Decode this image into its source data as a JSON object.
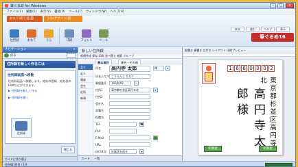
{
  "window": {
    "title": "筆ぐるめ for Windows"
  },
  "menu": [
    "ファイル(F)",
    "編集(E)",
    "表示(V)",
    "書式(O)",
    "ツール(T)",
    "ウィンドウ(W)",
    "ヘルプ(H)"
  ],
  "ribbon": {
    "tab_omote": "おもて(宛て名)面",
    "tab_ura": "うら(デザイン)面",
    "buttons": [
      "住所録",
      "おもて",
      "うら",
      "印刷",
      "フォント",
      "ツール"
    ],
    "mini_tabs": [
      "戻る",
      "進む",
      "ヘルプ",
      "表示"
    ],
    "brand": "筆ぐるめ16",
    "brand_color": "#c62d2d"
  },
  "left_panel": {
    "header": "ナビゲーション",
    "strip_label": "戻る",
    "section_title": "住所録を新しく作るには",
    "box_heading": "住所録画面へ移動",
    "para": "住所録画面へ移動します。宛先の登録、宛名面の印刷などができます。",
    "link1": "▶ 住所録を新しく作る",
    "link2": "▶ 住所録を開く",
    "pic_label": "住所録",
    "tail_button": "閉じる",
    "status": "ガイドに切り替え"
  },
  "address_book": {
    "title": "新しい住所録",
    "toolbar": "新規作成  保存  印刷  並べ替え  検索  グループ",
    "tabs": [
      "基本項目",
      "連名・その他"
    ],
    "groups": [
      "全て",
      "友人",
      "親戚",
      "会社",
      "近所",
      "新規"
    ],
    "fields": {
      "name_label": "氏名",
      "name_value": "高円寺 太郎",
      "honorific": "様",
      "furigana_label": "氏名ふりがな",
      "furigana_value": "こうえんじ たろう",
      "zip_label": "郵便番号",
      "zip_value": "1660002",
      "address_label": "住所1",
      "address_value": "東京都杉並区高円寺北",
      "address2_label": "住所2",
      "company_label": "会社名",
      "dept_label": "部署名",
      "title_label": "役職名",
      "tel_label": "TEL",
      "fax_label": "FAX",
      "email_label": "E-Mail",
      "url_label": "URL",
      "memo_label": "メモ",
      "mark_label": "マーク",
      "send_label": "送付状況",
      "send_value": "年賀状を送る"
    },
    "footer": [
      "カード",
      "一覧"
    ]
  },
  "preview": {
    "toolbar": "縦書き  横書き  はがき  レイアウト  印刷プレビュー",
    "zip_digits": [
      "1",
      "6",
      "6",
      "0",
      "0",
      "0",
      "2"
    ],
    "address_vertical": "東京都杉並区高円寺北",
    "name_vertical": "高円寺太郎様",
    "stamp_left": "年賀状",
    "stamp_right": "年賀状"
  },
  "status": {
    "left": "住所録1件目 / 1件"
  }
}
